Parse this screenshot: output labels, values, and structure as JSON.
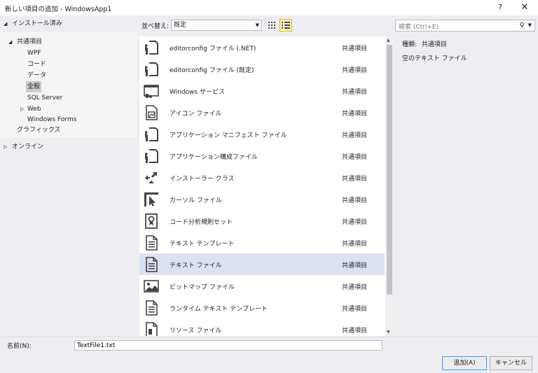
{
  "window": {
    "title": "新しい項目の追加 - WindowsApp1",
    "help": "?",
    "close": "✕"
  },
  "tree": {
    "installed": "インストール済み",
    "common": "共通項目",
    "children": [
      "WPF",
      "コード",
      "データ",
      "全般",
      "SQL Server",
      "Web",
      "Windows Forms"
    ],
    "graphics": "グラフィックス",
    "online": "オンライン"
  },
  "sort": {
    "label": "並べ替え:",
    "value": "既定"
  },
  "search": {
    "placeholder": "検索 (Ctrl+E)"
  },
  "items": [
    {
      "name": "editorconfig ファイル (.NET)",
      "category": "共通項目",
      "icon": "config-file-icon"
    },
    {
      "name": "editorconfig ファイル (既定)",
      "category": "共通項目",
      "icon": "config-file-icon"
    },
    {
      "name": "Windows サービス",
      "category": "共通項目",
      "icon": "windows-service-icon"
    },
    {
      "name": "アイコン ファイル",
      "category": "共通項目",
      "icon": "icon-file-icon"
    },
    {
      "name": "アプリケーション マニフェスト ファイル",
      "category": "共通項目",
      "icon": "config-file-icon"
    },
    {
      "name": "アプリケーション構成ファイル",
      "category": "共通項目",
      "icon": "config-file-icon"
    },
    {
      "name": "インストーラー クラス",
      "category": "共通項目",
      "icon": "installer-class-icon"
    },
    {
      "name": "カーソル ファイル",
      "category": "共通項目",
      "icon": "cursor-file-icon"
    },
    {
      "name": "コード分析規則セット",
      "category": "共通項目",
      "icon": "ruleset-icon"
    },
    {
      "name": "テキスト テンプレート",
      "category": "共通項目",
      "icon": "text-file-icon"
    },
    {
      "name": "テキスト ファイル",
      "category": "共通項目",
      "icon": "text-file-icon"
    },
    {
      "name": "ビットマップ ファイル",
      "category": "共通項目",
      "icon": "bitmap-file-icon"
    },
    {
      "name": "ランタイム テキスト テンプレート",
      "category": "共通項目",
      "icon": "text-file-icon"
    },
    {
      "name": "リソース ファイル",
      "category": "共通項目",
      "icon": "resource-file-icon"
    }
  ],
  "info": {
    "type_label": "種類:",
    "type_value": "共通項目",
    "description": "空のテキスト ファイル"
  },
  "bottom": {
    "name_label": "名前(N):",
    "name_value": "TextFile1.txt",
    "add": "追加(A)",
    "cancel": "キャンセル"
  },
  "colors": {
    "selection": "#dde1f4",
    "tree_selected": "#cccccc",
    "accent": "#3399ff"
  }
}
